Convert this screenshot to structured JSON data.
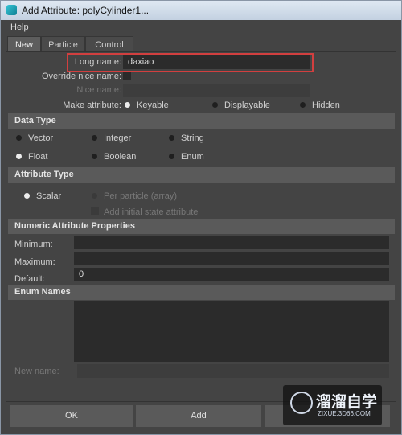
{
  "window": {
    "title": "Add Attribute: polyCylinder1..."
  },
  "menu": {
    "help": "Help"
  },
  "tabs": [
    {
      "label": "New"
    },
    {
      "label": "Particle"
    },
    {
      "label": "Control"
    }
  ],
  "form": {
    "long_name_label": "Long name:",
    "long_name_value": "daxiao",
    "override_nice_name_label": "Override nice name:",
    "nice_name_label": "Nice name:",
    "make_attribute_label": "Make attribute:",
    "make_attribute_options": [
      "Keyable",
      "Displayable",
      "Hidden"
    ],
    "make_attribute_selected": "Keyable"
  },
  "data_type": {
    "heading": "Data Type",
    "options": [
      "Vector",
      "Integer",
      "String",
      "Float",
      "Boolean",
      "Enum"
    ],
    "selected": "Float"
  },
  "attribute_type": {
    "heading": "Attribute Type",
    "options": [
      "Scalar",
      "Per particle (array)"
    ],
    "selected": "Scalar",
    "initial_state_label": "Add initial state attribute"
  },
  "numeric": {
    "heading": "Numeric Attribute Properties",
    "minimum_label": "Minimum:",
    "maximum_label": "Maximum:",
    "default_label": "Default:",
    "minimum_value": "",
    "maximum_value": "",
    "default_value": "0"
  },
  "enum": {
    "heading": "Enum Names",
    "new_name_label": "New name:"
  },
  "buttons": {
    "ok": "OK",
    "add": "Add"
  },
  "watermark": {
    "brand": "溜溜自学",
    "site": "ZIXUE.3D66.COM"
  }
}
